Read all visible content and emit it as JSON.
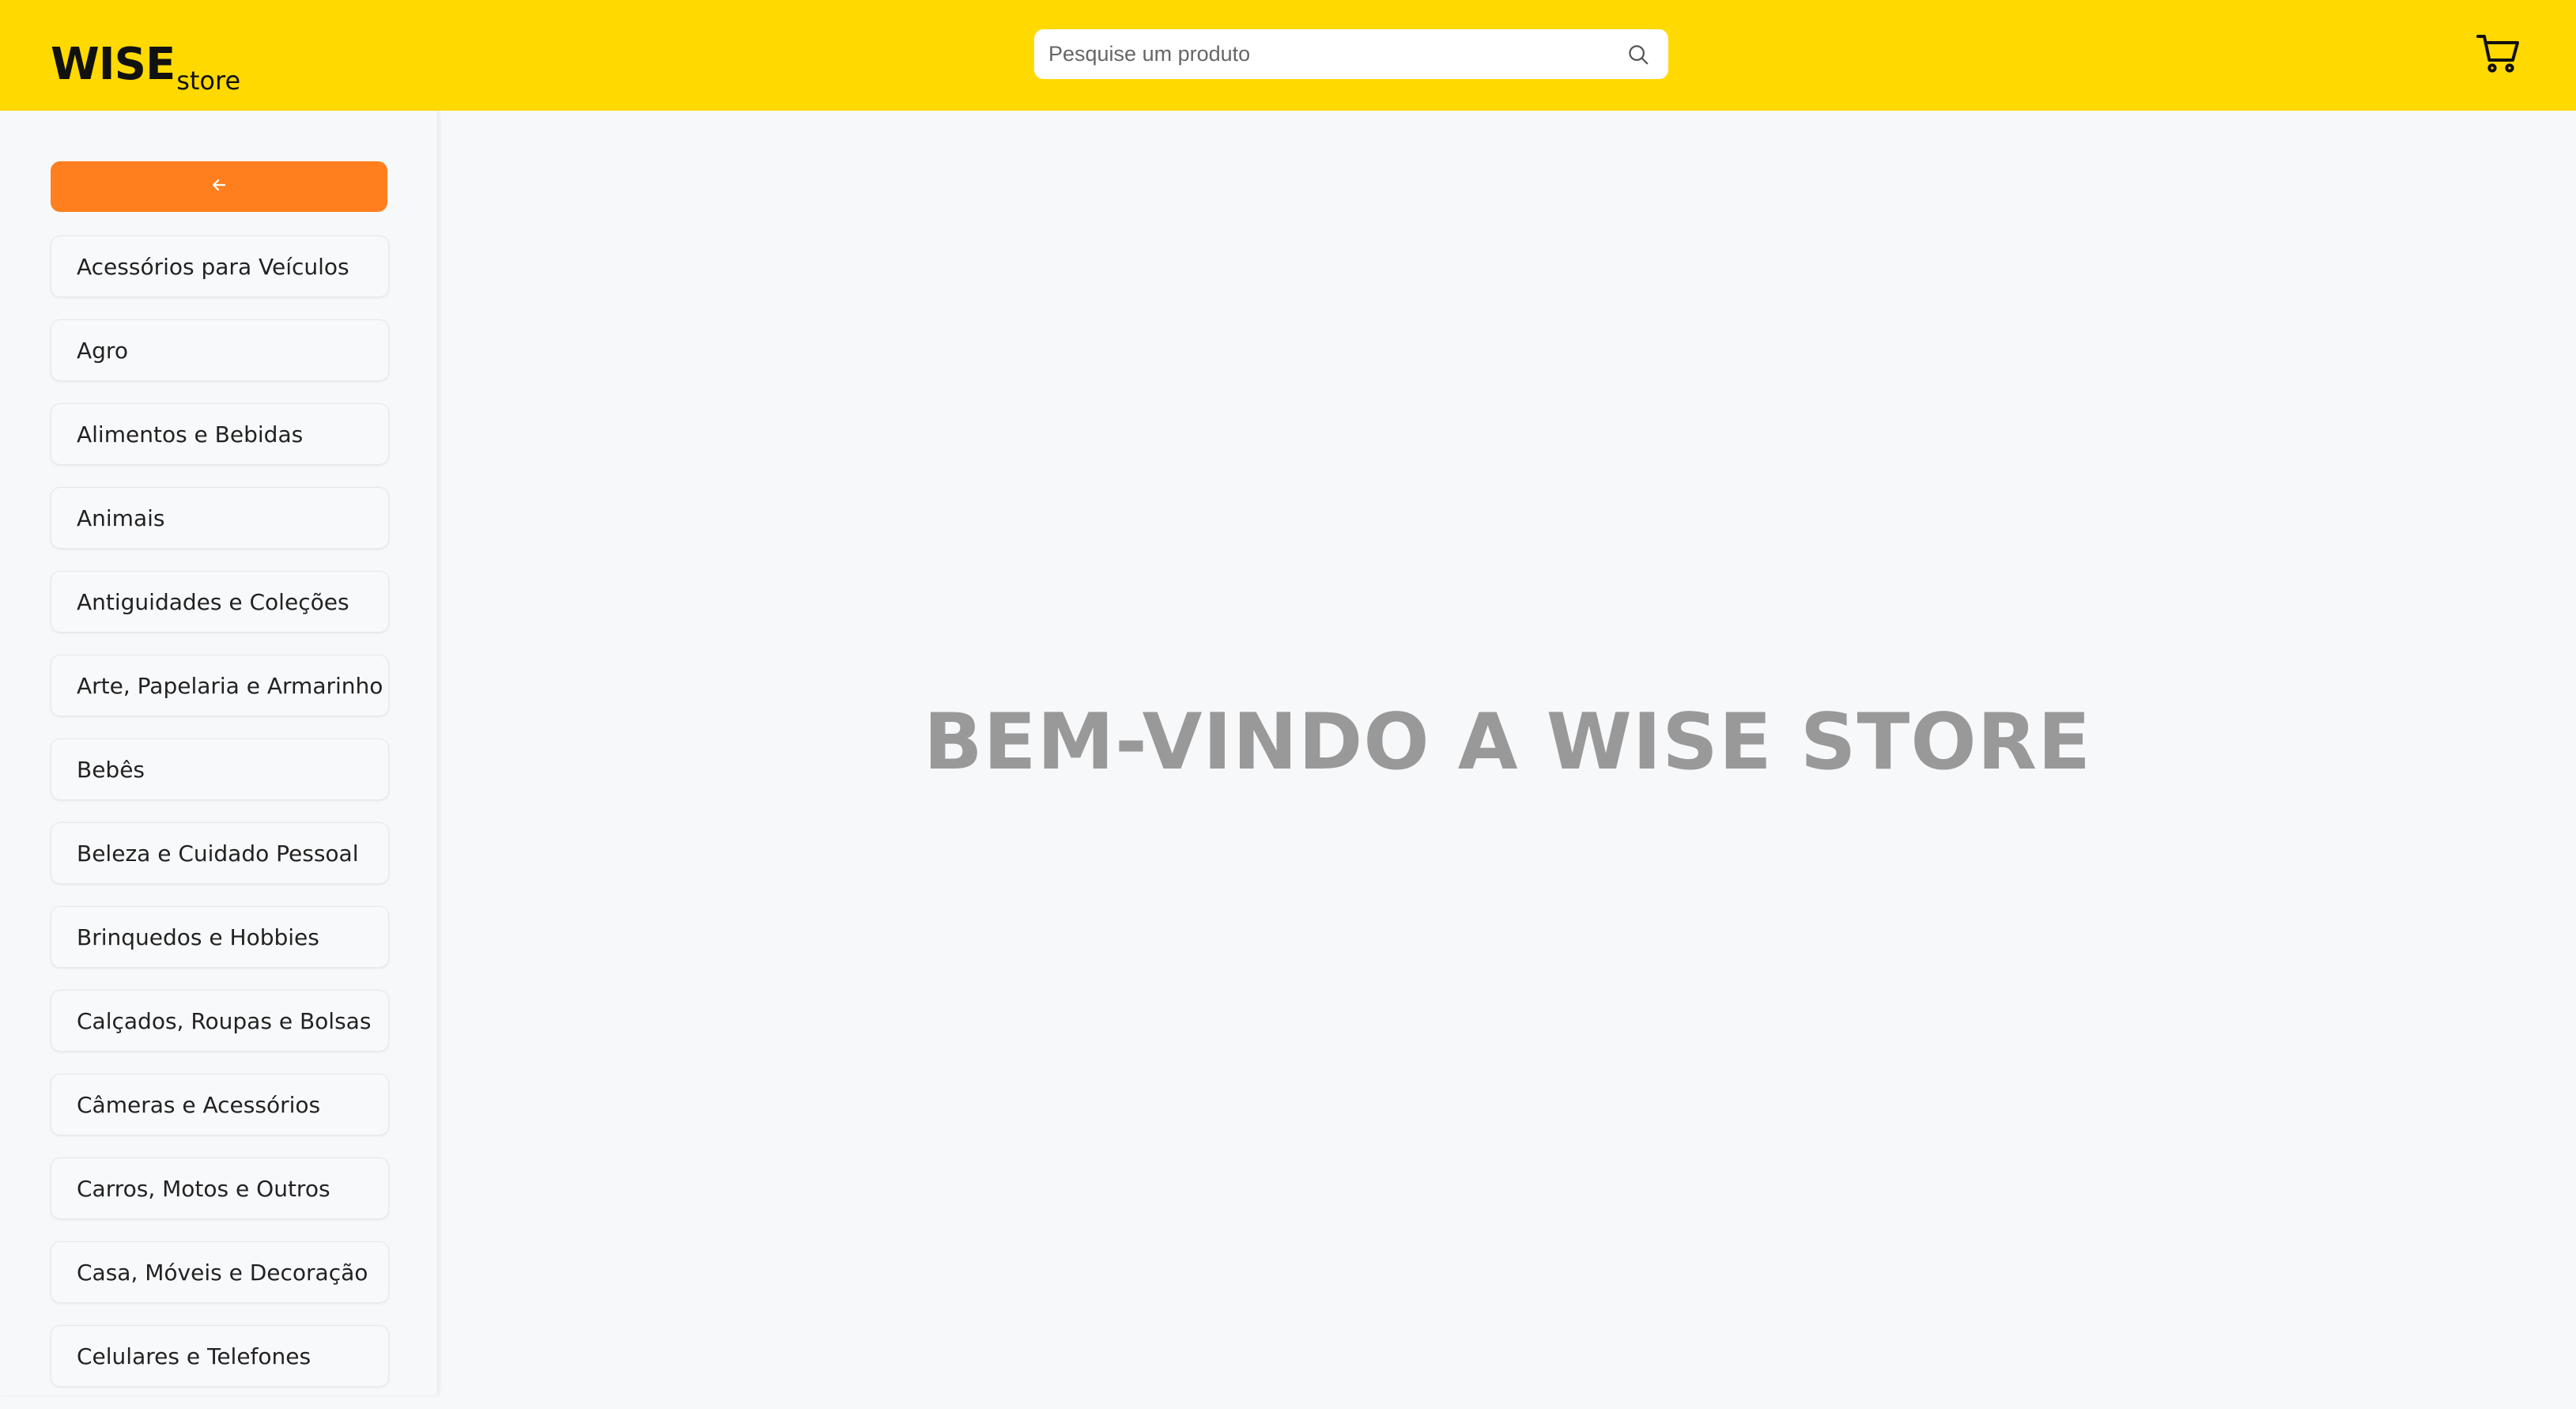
{
  "header": {
    "logo_main": "WISE",
    "logo_sub": "store",
    "search_placeholder": "Pesquise um produto",
    "search_icon": "search-icon",
    "cart_icon": "cart-icon"
  },
  "sidebar": {
    "back_button_icon": "arrow-left-icon",
    "categories": [
      "Acessórios para Veículos",
      "Agro",
      "Alimentos e Bebidas",
      "Animais",
      "Antiguidades e Coleções",
      "Arte, Papelaria e Armarinho",
      "Bebês",
      "Beleza e Cuidado Pessoal",
      "Brinquedos e Hobbies",
      "Calçados, Roupas e Bolsas",
      "Câmeras e Acessórios",
      "Carros, Motos e Outros",
      "Casa, Móveis e Decoração",
      "Celulares e Telefones"
    ]
  },
  "main": {
    "welcome_title": "BEM-VINDO A WISE STORE"
  },
  "colors": {
    "header_bg": "#FFD900",
    "accent_button": "#FF7F1E",
    "page_bg": "#F7F8FA",
    "welcome_text": "#999999"
  }
}
